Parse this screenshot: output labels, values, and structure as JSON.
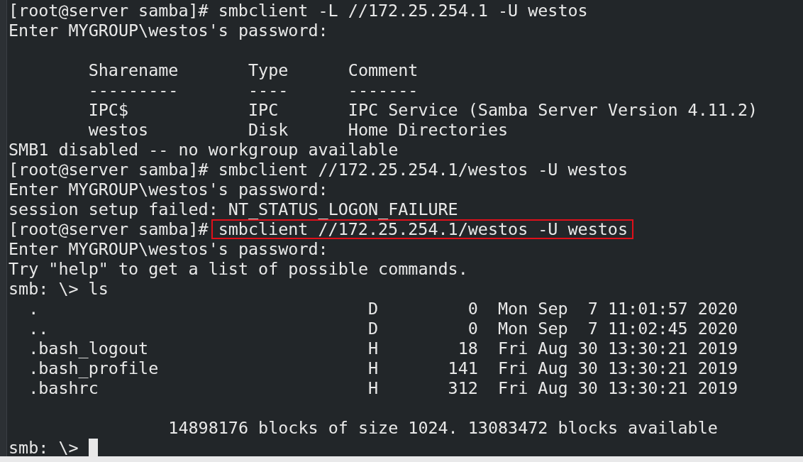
{
  "terminal": {
    "lines": [
      {
        "kind": "command",
        "prompt": "[root@server samba]#",
        "command": "smbclient -L //172.25.254.1 -U westos",
        "highlighted": false
      },
      {
        "kind": "output",
        "text": "Enter MYGROUP\\westos's password:"
      },
      {
        "kind": "blank"
      },
      {
        "kind": "output",
        "text": "        Sharename       Type      Comment"
      },
      {
        "kind": "output",
        "text": "        ---------       ----      -------"
      },
      {
        "kind": "output",
        "text": "        IPC$            IPC       IPC Service (Samba Server Version 4.11.2)"
      },
      {
        "kind": "output",
        "text": "        westos          Disk      Home Directories"
      },
      {
        "kind": "output",
        "text": "SMB1 disabled -- no workgroup available"
      },
      {
        "kind": "command",
        "prompt": "[root@server samba]#",
        "command": "smbclient //172.25.254.1/westos -U westos",
        "highlighted": false
      },
      {
        "kind": "output",
        "text": "Enter MYGROUP\\westos's password:"
      },
      {
        "kind": "output",
        "text": "session setup failed: NT_STATUS_LOGON_FAILURE"
      },
      {
        "kind": "command",
        "prompt": "[root@server samba]#",
        "command": "smbclient //172.25.254.1/westos -U westos",
        "highlighted": true
      },
      {
        "kind": "output",
        "text": "Enter MYGROUP\\westos's password:"
      },
      {
        "kind": "output",
        "text": "Try \"help\" to get a list of possible commands."
      },
      {
        "kind": "command",
        "prompt": "smb: \\>",
        "command": "ls",
        "highlighted": false
      },
      {
        "kind": "output",
        "text": "  .                                 D         0  Mon Sep  7 11:01:57 2020"
      },
      {
        "kind": "output",
        "text": "  ..                                D         0  Mon Sep  7 11:02:45 2020"
      },
      {
        "kind": "output",
        "text": "  .bash_logout                      H        18  Fri Aug 30 13:30:21 2019"
      },
      {
        "kind": "output",
        "text": "  .bash_profile                     H       141  Fri Aug 30 13:30:21 2019"
      },
      {
        "kind": "output",
        "text": "  .bashrc                           H       312  Fri Aug 30 13:30:21 2019"
      },
      {
        "kind": "blank"
      },
      {
        "kind": "output",
        "text": "                14898176 blocks of size 1024. 13083472 blocks available"
      },
      {
        "kind": "input",
        "prompt": "smb: \\>",
        "cursor": true
      }
    ]
  }
}
